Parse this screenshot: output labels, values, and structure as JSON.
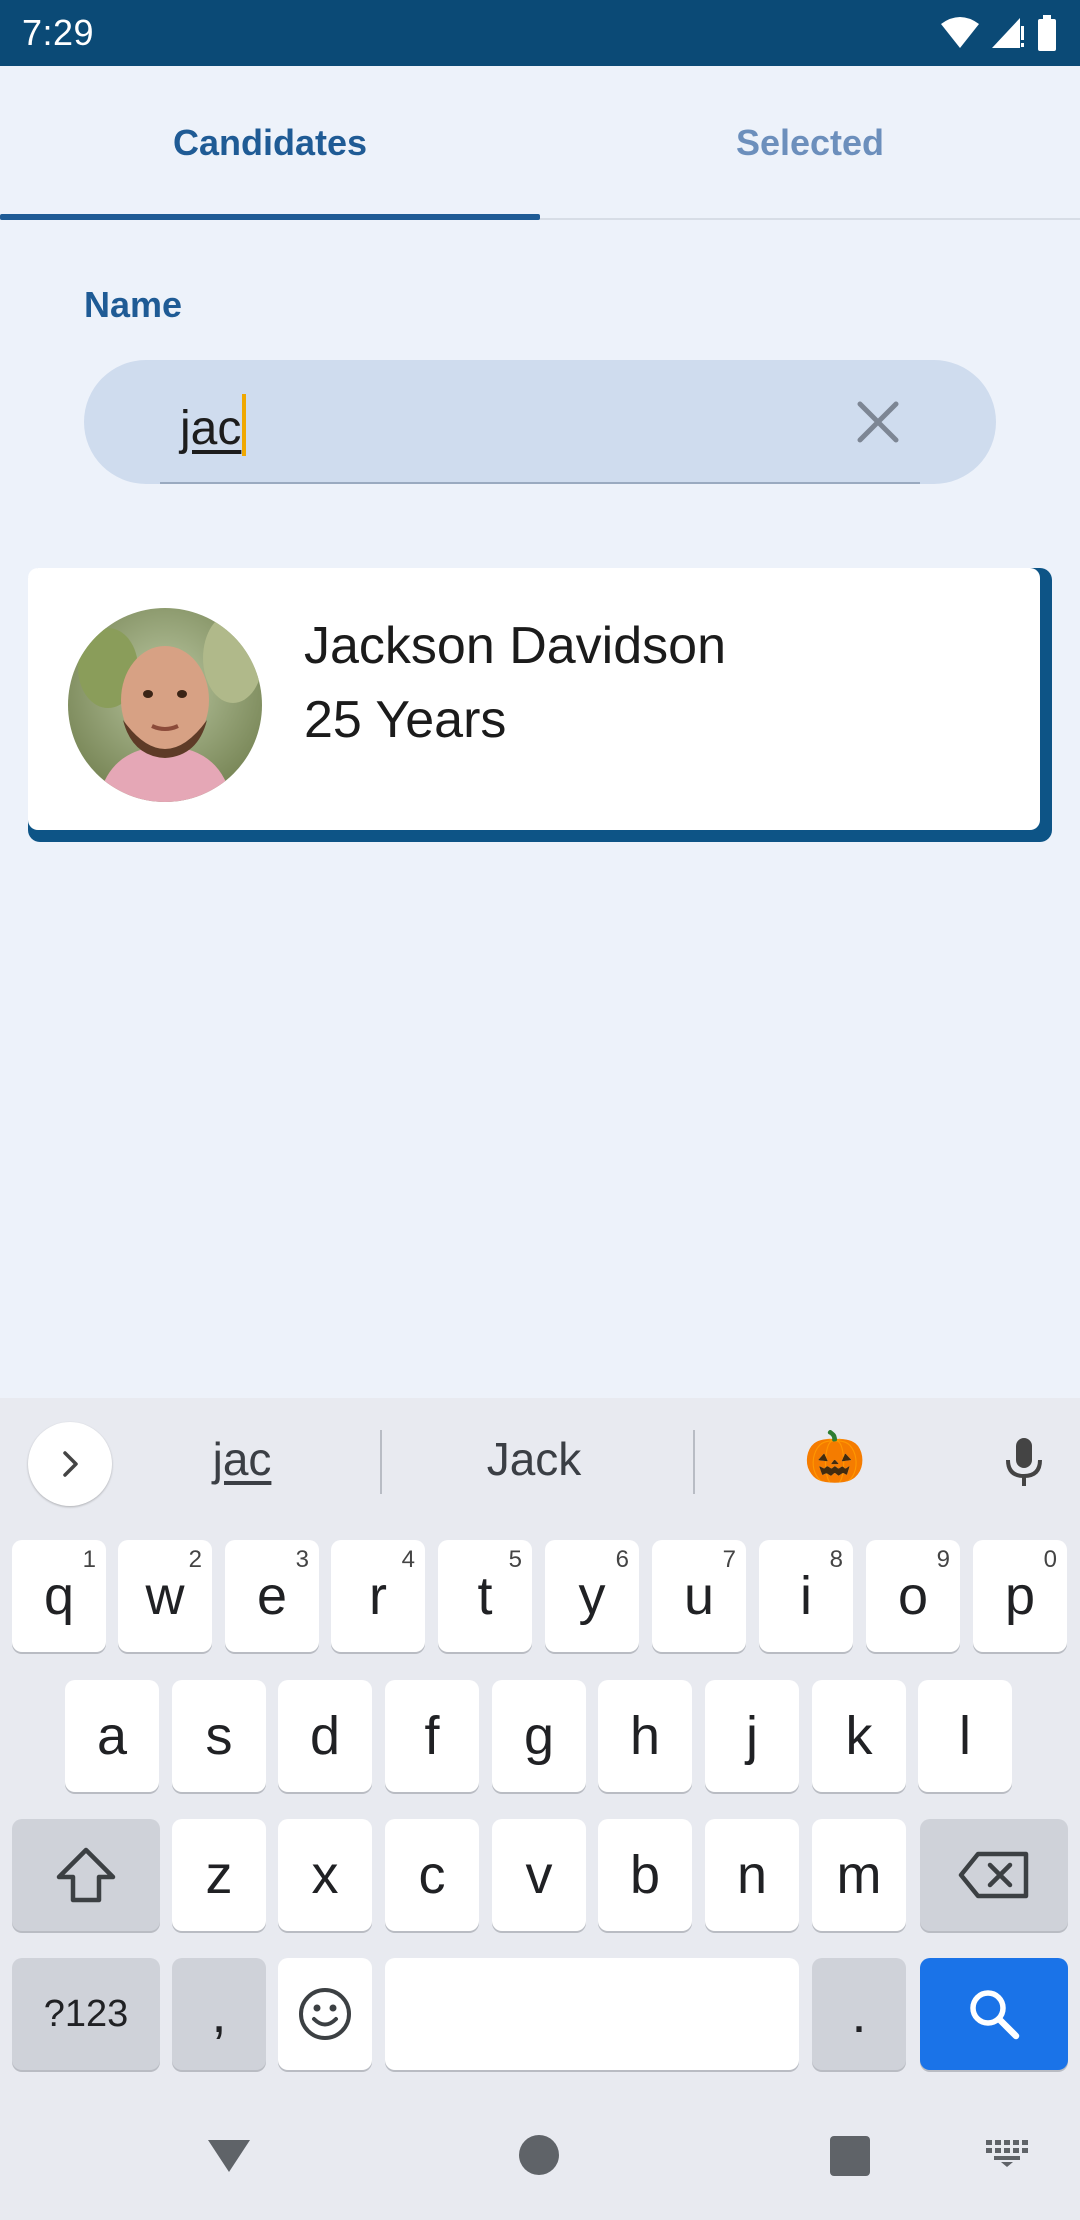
{
  "status_bar": {
    "time": "7:29",
    "icons": [
      "wifi-icon",
      "cell-signal-icon",
      "battery-icon"
    ]
  },
  "tabs": [
    {
      "label": "Candidates",
      "active": true
    },
    {
      "label": "Selected",
      "active": false
    }
  ],
  "filter": {
    "label": "Name",
    "value": "jac",
    "clear_icon": "close-icon"
  },
  "results": [
    {
      "name": "Jackson Davidson",
      "age": "25 Years",
      "avatar": "profile-photo"
    }
  ],
  "keyboard": {
    "suggestions": [
      "jac",
      "Jack",
      "🎃"
    ],
    "row1": [
      {
        "k": "q",
        "n": "1"
      },
      {
        "k": "w",
        "n": "2"
      },
      {
        "k": "e",
        "n": "3"
      },
      {
        "k": "r",
        "n": "4"
      },
      {
        "k": "t",
        "n": "5"
      },
      {
        "k": "y",
        "n": "6"
      },
      {
        "k": "u",
        "n": "7"
      },
      {
        "k": "i",
        "n": "8"
      },
      {
        "k": "o",
        "n": "9"
      },
      {
        "k": "p",
        "n": "0"
      }
    ],
    "row2": [
      "a",
      "s",
      "d",
      "f",
      "g",
      "h",
      "j",
      "k",
      "l"
    ],
    "row3": [
      "z",
      "x",
      "c",
      "v",
      "b",
      "n",
      "m"
    ],
    "symbols_label": "?123",
    "comma": ",",
    "period": ".",
    "colors": {
      "action": "#1a73e8",
      "tab_active": "#1f5b95",
      "status_bar": "#0b4a76"
    }
  },
  "nav": [
    "back-icon",
    "home-icon",
    "recents-icon",
    "keyboard-switch-icon"
  ]
}
